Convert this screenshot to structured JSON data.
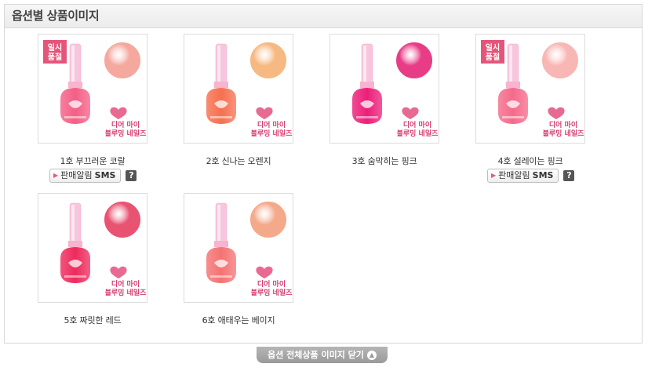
{
  "section_title": "옵션별 상품이미지",
  "products": [
    {
      "caption": "1호 부끄러운 코랄",
      "badge": [
        "일시",
        "품절"
      ],
      "sms": true,
      "bottle": "#f45f86",
      "swatch": "#f5a89d"
    },
    {
      "caption": "2호 신나는 오렌지",
      "badge": null,
      "sms": false,
      "bottle": "#f6704f",
      "swatch": "#f7b982"
    },
    {
      "caption": "3호 숨막히는 핑크",
      "badge": null,
      "sms": false,
      "bottle": "#ec1f79",
      "swatch": "#e83c86"
    },
    {
      "caption": "4호 설레이는 핑크",
      "badge": [
        "일시",
        "품절"
      ],
      "sms": true,
      "bottle": "#f56a8a",
      "swatch": "#f8b7b4"
    },
    {
      "caption": "5호 짜릿한 레드",
      "badge": null,
      "sms": false,
      "bottle": "#ee2a5c",
      "swatch": "#e95372"
    },
    {
      "caption": "6호 애태우는 베이지",
      "badge": null,
      "sms": false,
      "bottle": "#f47373",
      "swatch": "#f4a98a"
    }
  ],
  "product_logo": [
    "디어 마이",
    "블루밍 네일즈"
  ],
  "sms_button": {
    "prefix": "판매알림",
    "suffix": "SMS"
  },
  "help_label": "?",
  "footer_button": "옵션 전체상품 이미지 닫기"
}
